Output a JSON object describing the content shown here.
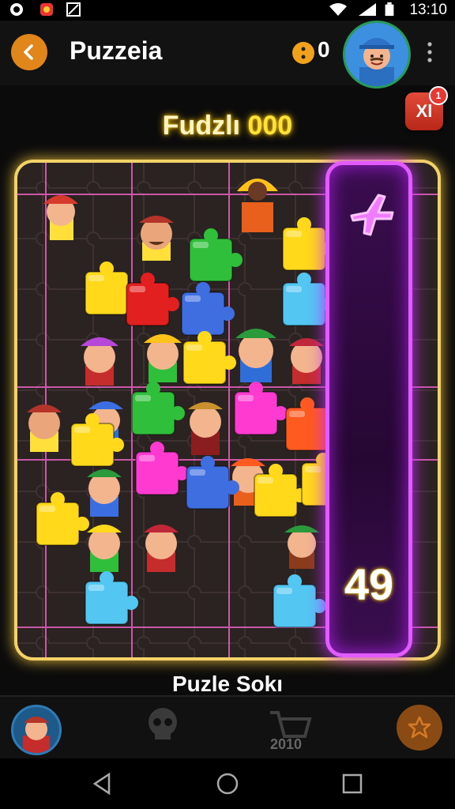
{
  "status_bar": {
    "time": "13:10",
    "icons": [
      "app-icon",
      "notification-icon",
      "image-icon",
      "wifi-icon",
      "signal-icon",
      "battery-icon"
    ]
  },
  "header": {
    "title": "Puzzeia",
    "coins": "0",
    "badge_label": "Xl",
    "badge_count": "1"
  },
  "score": {
    "label": "Fudzlı",
    "value": "000"
  },
  "board": {
    "counter": "49",
    "side_icon": "airplane-icon",
    "pieces": [
      {
        "color": "#ffd91a",
        "kind": "puzzle"
      },
      {
        "color": "#2fbf3a",
        "kind": "puzzle"
      },
      {
        "color": "#e32020",
        "kind": "puzzle"
      },
      {
        "color": "#3f6ee0",
        "kind": "puzzle"
      },
      {
        "color": "#ff3ad1",
        "kind": "puzzle"
      },
      {
        "color": "#ff5a1f",
        "kind": "puzzle"
      },
      {
        "color": "#53c7f2",
        "kind": "puzzle"
      }
    ]
  },
  "footer": {
    "label": "Puzle Sokı"
  },
  "bottom_nav": {
    "cart_label": "2010",
    "items": [
      "avatar",
      "skull-icon",
      "cart-icon",
      "star-icon"
    ]
  },
  "colors": {
    "accent_gold": "#f3d26a",
    "accent_purple": "#e15bff",
    "back_orange": "#e0861b"
  }
}
